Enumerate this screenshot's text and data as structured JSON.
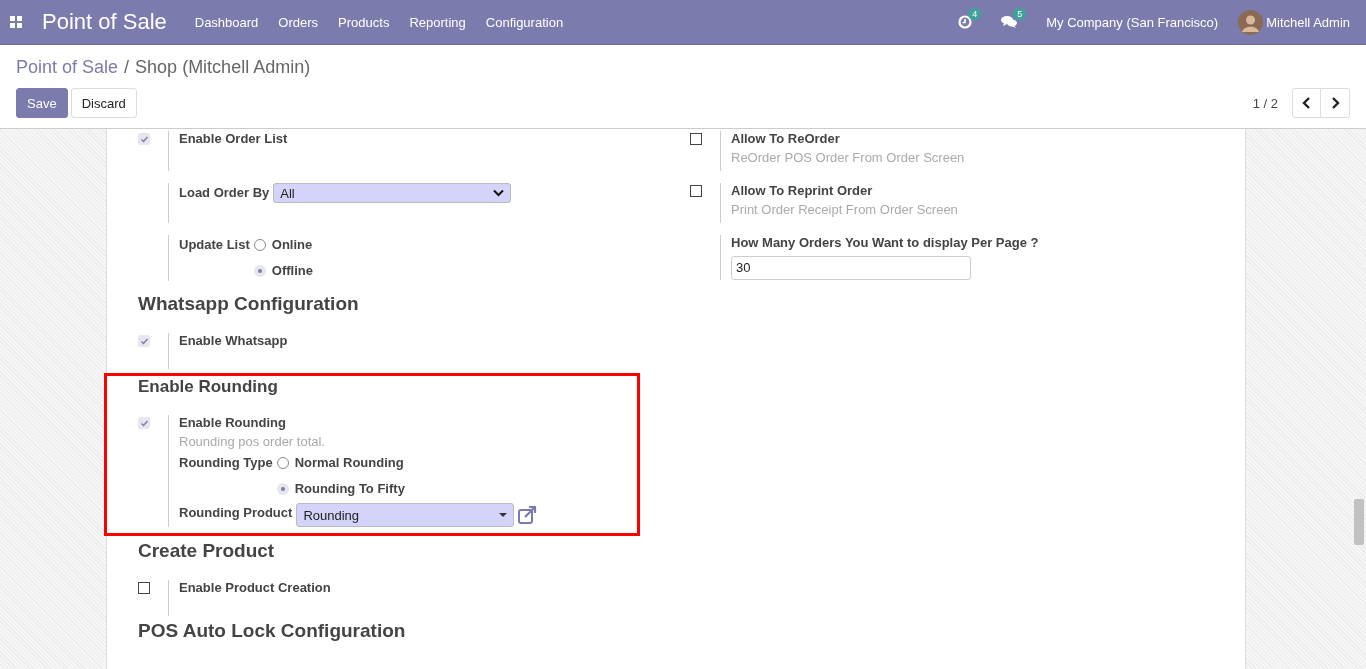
{
  "navbar": {
    "app_title": "Point of Sale",
    "menu": [
      "Dashboard",
      "Orders",
      "Products",
      "Reporting",
      "Configuration"
    ],
    "activity_count": "4",
    "message_count": "5",
    "company": "My Company (San Francisco)",
    "user": "Mitchell Admin"
  },
  "breadcrumb": {
    "items": [
      "Point of Sale",
      "Shop (Mitchell Admin)"
    ],
    "separator": "/"
  },
  "buttons": [
    {
      "label": "Save",
      "kind": "primary"
    },
    {
      "label": "Discard",
      "kind": "secondary"
    }
  ],
  "pager": "1 / 2",
  "order_settings": {
    "left": [
      {
        "checked": true,
        "label": "Enable Order List"
      },
      {
        "fields": [
          {
            "kind": "select",
            "label": "Load Order By",
            "value": "All"
          }
        ]
      },
      {
        "fields": [
          {
            "kind": "radio",
            "label": "Update List",
            "options": [
              {
                "label": "Online",
                "selected": false
              },
              {
                "label": "Offline",
                "selected": true
              }
            ]
          }
        ]
      }
    ],
    "right": [
      {
        "checked": false,
        "label": "Allow To ReOrder",
        "description": "ReOrder POS Order From Order Screen"
      },
      {
        "checked": false,
        "label": "Allow To Reprint Order",
        "description": "Print Order Receipt From Order Screen"
      },
      {
        "label": "How Many Orders You Want to display Per Page ?",
        "fields": [
          {
            "kind": "input",
            "value": "30"
          }
        ]
      }
    ]
  },
  "sections": [
    {
      "title": "Whatsapp Configuration",
      "highlighted": false,
      "settings": [
        {
          "checked": true,
          "label": "Enable Whatsapp"
        }
      ]
    },
    {
      "title": "Enable Rounding",
      "highlighted": true,
      "settings": [
        {
          "checked": true,
          "label": "Enable Rounding",
          "description": "Rounding pos order total.",
          "fields": [
            {
              "kind": "radio",
              "label": "Rounding Type",
              "options": [
                {
                  "label": "Normal Rounding",
                  "selected": false
                },
                {
                  "label": "Rounding To Fifty",
                  "selected": true
                }
              ]
            },
            {
              "kind": "many2one",
              "label": "Rounding Product",
              "value": "Rounding"
            }
          ]
        }
      ]
    },
    {
      "title": "Create Product",
      "highlighted": false,
      "settings": [
        {
          "checked": false,
          "label": "Enable Product Creation"
        }
      ]
    },
    {
      "title": "POS Auto Lock Configuration",
      "highlighted": false
    }
  ]
}
